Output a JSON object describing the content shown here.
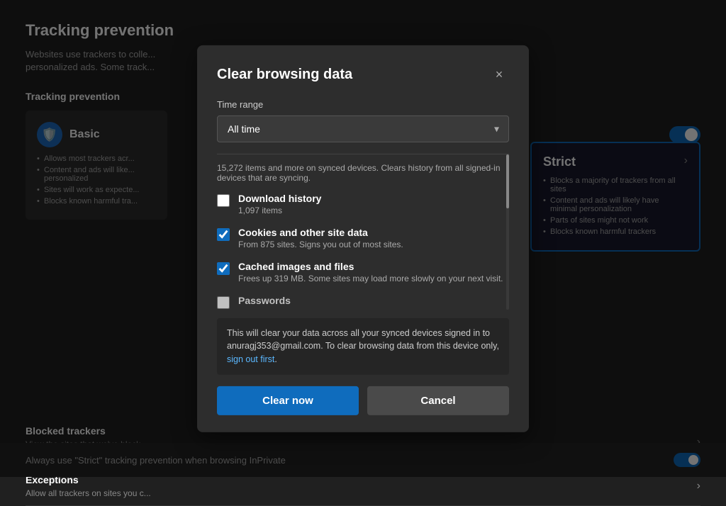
{
  "page": {
    "title": "Tracking prevention"
  },
  "background": {
    "title": "Tracking prevention",
    "subtitle": "Websites use trackers to colle... personalized ads. Some track...",
    "tracking_section_title": "Tracking prevention",
    "basic_card": {
      "title": "Basic",
      "icon": "🛡️",
      "bullets": [
        "Allows most trackers acr...",
        "Content and ads will like... personalized",
        "Sites will work as expecte...",
        "Blocks known harmful tra..."
      ]
    },
    "strict_card": {
      "title": "Strict",
      "bullets": [
        "Blocks a majority of trackers from all sites",
        "Content and ads will likely have minimal personalization",
        "Parts of sites might not work",
        "Blocks known harmful trackers"
      ]
    },
    "blocked_trackers": {
      "title": "Blocked trackers",
      "subtitle": "View the sites that we've block..."
    },
    "exceptions": {
      "title": "Exceptions",
      "subtitle": "Allow all trackers on sites you c..."
    },
    "bottom_bar": {
      "text": "Always use \"Strict\" tracking prevention when browsing InPrivate"
    }
  },
  "modal": {
    "title": "Clear browsing data",
    "close_label": "×",
    "time_range_label": "Time range",
    "time_range_value": "All time",
    "checkboxes": [
      {
        "id": "download-history",
        "label": "Download history",
        "sub": "1,097 items",
        "checked": false
      },
      {
        "id": "cookies",
        "label": "Cookies and other site data",
        "sub": "From 875 sites. Signs you out of most sites.",
        "checked": true
      },
      {
        "id": "cached",
        "label": "Cached images and files",
        "sub": "Frees up 319 MB. Some sites may load more slowly on your next visit.",
        "checked": true
      },
      {
        "id": "passwords",
        "label": "Passwords",
        "sub": "",
        "checked": false
      }
    ],
    "scroll_note": "15,272 items and more on synced devices. Clears history from all signed-in devices that are syncing.",
    "info_text_before": "This will clear your data across all your synced devices signed in to anuragj353@gmail.com. To clear browsing data from this device only, ",
    "info_link": "sign out first",
    "info_text_after": ".",
    "clear_button": "Clear now",
    "cancel_button": "Cancel"
  }
}
